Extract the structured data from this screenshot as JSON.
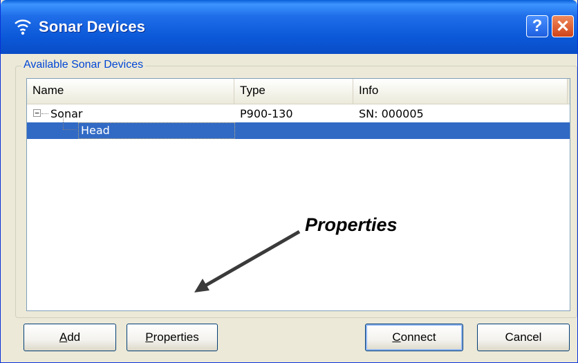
{
  "window": {
    "title": "Sonar Devices",
    "help_label": "?",
    "close_label": "✕"
  },
  "group": {
    "legend": "Available Sonar Devices"
  },
  "list": {
    "columns": [
      "Name",
      "Type",
      "Info"
    ],
    "rows": [
      {
        "name": "Sonar",
        "type": "P900-130",
        "info": "SN: 000005",
        "expanded": true,
        "selected": false
      },
      {
        "name": "Head",
        "type": "",
        "info": "",
        "selected": true
      }
    ]
  },
  "annotation": {
    "text": "Properties"
  },
  "buttons": {
    "add": {
      "mnemonic": "A",
      "rest": "dd"
    },
    "properties": {
      "mnemonic": "P",
      "rest": "roperties"
    },
    "connect": {
      "mnemonic": "C",
      "rest": "onnect"
    },
    "cancel": {
      "label": "Cancel"
    }
  },
  "colors": {
    "titlebar": "#0a5fd8",
    "selection": "#316ac5",
    "legend_text": "#0046d5",
    "close_button": "#d0431a"
  },
  "icons": {
    "title": "wifi-signal-icon",
    "expander": "minus-box-icon"
  }
}
